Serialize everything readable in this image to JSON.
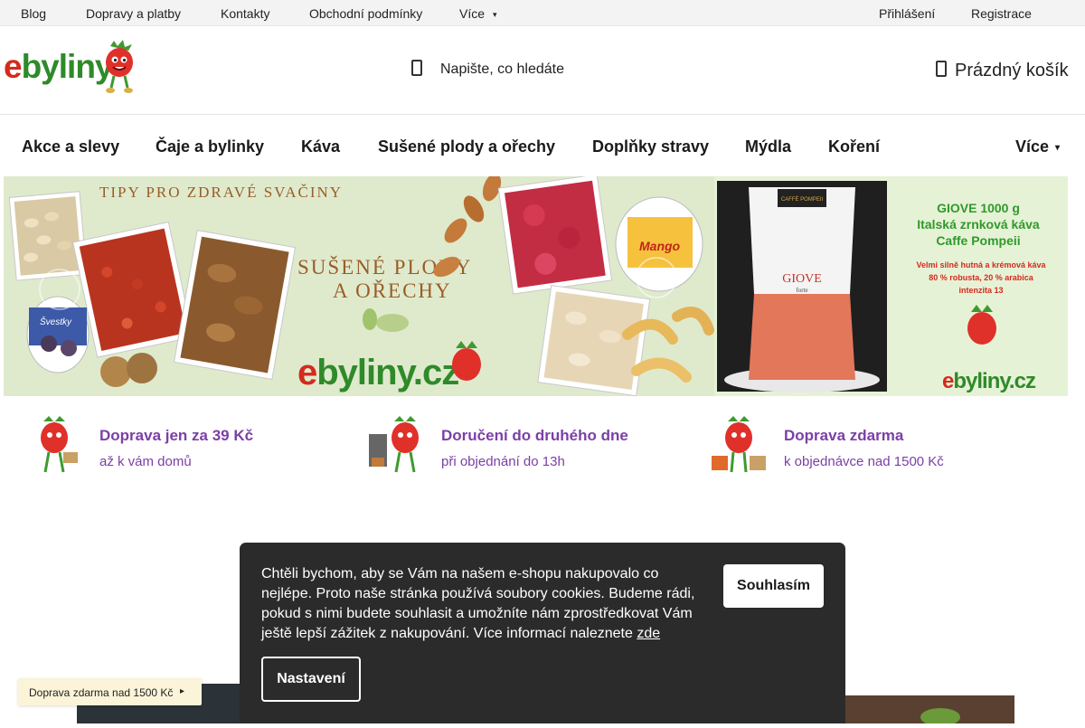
{
  "topbar": {
    "links": [
      "Blog",
      "Dopravy a platby",
      "Kontakty",
      "Obchodní podmínky"
    ],
    "more_label": "Více",
    "login": "Přihlášení",
    "register": "Registrace"
  },
  "header": {
    "logo_text_e": "e",
    "logo_text_rest": "byliny",
    "search_placeholder": "Napište, co hledáte",
    "cart_label": "Prázdný košík"
  },
  "nav": {
    "items": [
      "Akce a slevy",
      "Čaje a bylinky",
      "Káva",
      "Sušené plody a ořechy",
      "Doplňky stravy",
      "Mýdla",
      "Koření"
    ],
    "more_label": "Více"
  },
  "banner_main": {
    "headline": "TIPY PRO ZDRAVÉ SVAČINY",
    "title_line1": "SUŠENÉ PLODY",
    "title_line2": "A OŘECHY",
    "brand_e": "e",
    "brand_rest": "byliny.cz",
    "jar_label_mango": "Mango",
    "jar_label_svestky": "Švestky"
  },
  "banner_side": {
    "product_line1": "GIOVE 1000 g",
    "product_line2": "Italská zrnková káva",
    "product_line3": "Caffe Pompeii",
    "desc_line1": "Velmi silně hutná a krémová káva",
    "desc_line2": "80 % robusta, 20 % arabica",
    "desc_line3": "intenzita 13",
    "brand_e": "e",
    "brand_rest": "byliny.cz",
    "bag_brand": "CAFFÈ POMPEII",
    "bag_name": "GIOVE",
    "bag_strength": "forte"
  },
  "usps": [
    {
      "title": "Doprava jen za 39 Kč",
      "subtitle": "až k vám domů"
    },
    {
      "title": "Doručení do druhého dne",
      "subtitle": "při objednání do 13h"
    },
    {
      "title": "Doprava zdarma",
      "subtitle": "k objednávce nad 1500 Kč"
    }
  ],
  "cookie": {
    "message": "Chtěli bychom, aby se Vám na našem e-shopu nakupovalo co nejlépe. Proto naše stránka používá soubory cookies. Budeme rádi, pokud s nimi budete souhlasit a umožníte nám zprostředkovat Vám ještě lepší zážitek z nakupování. Více informací naleznete",
    "link": "zde",
    "accept": "Souhlasím",
    "settings": "Nastavení"
  },
  "shipping_bar": {
    "text": "Doprava zdarma nad 1500 Kč"
  },
  "colors": {
    "accent_purple": "#7b3fa6",
    "brand_green": "#2f8a2a",
    "brand_red": "#d42a1e",
    "cookie_bg": "#2b2b2b",
    "topbar_bg": "#f3f3f3"
  }
}
